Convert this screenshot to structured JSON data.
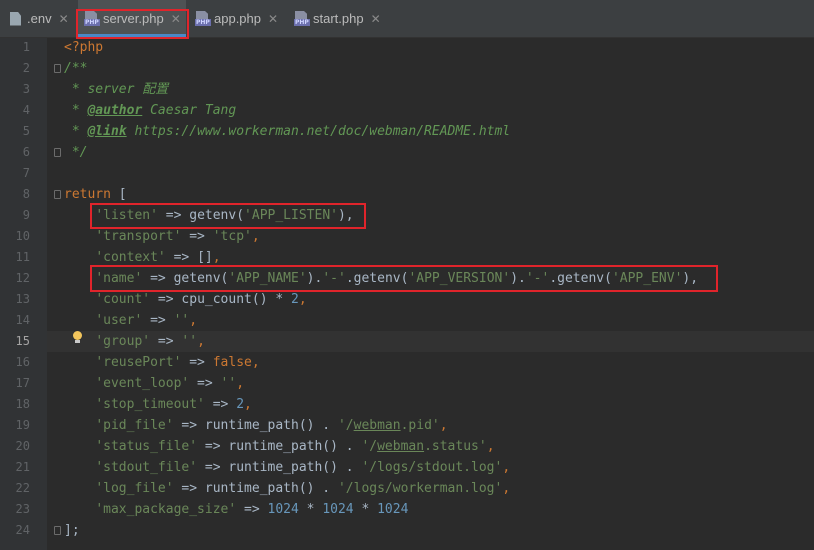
{
  "tabs": [
    {
      "label": ".env",
      "icon": "file-icon",
      "active": false
    },
    {
      "label": "server.php",
      "icon": "php-file-icon",
      "active": true
    },
    {
      "label": "app.php",
      "icon": "php-file-icon",
      "active": false
    },
    {
      "label": "start.php",
      "icon": "php-file-icon",
      "active": false
    }
  ],
  "close_glyph": "✕",
  "line_numbers": [
    "1",
    "2",
    "3",
    "4",
    "5",
    "6",
    "7",
    "8",
    "9",
    "10",
    "11",
    "12",
    "13",
    "14",
    "15",
    "16",
    "17",
    "18",
    "19",
    "20",
    "21",
    "22",
    "23",
    "24"
  ],
  "current_line": "15",
  "code": {
    "l1": {
      "open": "<?php"
    },
    "l2": {
      "text": "/**"
    },
    "l3": {
      "text": " * server 配置"
    },
    "l4": {
      "tag": "@author",
      "rest": " Caesar Tang"
    },
    "l5": {
      "tag": "@link",
      "rest": " https://www.workerman.net/doc/webman/README.html"
    },
    "l6": {
      "text": " */"
    },
    "l8": {
      "kw": "return",
      "rest": " ["
    },
    "l9": {
      "key": "'listen'",
      "arrow": " => ",
      "fn": "getenv(",
      "arg": "'APP_LISTEN'",
      "end": "),"
    },
    "l10": {
      "key": "'transport'",
      "arrow": " => ",
      "val": "'tcp'",
      "end": ","
    },
    "l11": {
      "key": "'context'",
      "arrow": " => ",
      "rest": "[]",
      "end": ","
    },
    "l12": {
      "key": "'name'",
      "arrow": " => ",
      "fn1": "getenv(",
      "a1": "'APP_NAME'",
      "c1": ").",
      "s1": "'-'",
      "c2": ".getenv(",
      "a2": "'APP_VERSION'",
      "c3": ").",
      "s2": "'-'",
      "c4": ".getenv(",
      "a3": "'APP_ENV'",
      "end": "),"
    },
    "l13": {
      "key": "'count'",
      "arrow": " => ",
      "fn": "cpu_count() * ",
      "num": "2",
      "end": ","
    },
    "l14": {
      "key": "'user'",
      "arrow": " => ",
      "val": "''",
      "end": ","
    },
    "l15": {
      "key": "'group'",
      "arrow": " => ",
      "val": "''",
      "end": ","
    },
    "l16": {
      "key": "'reusePort'",
      "arrow": " => ",
      "kwv": "false",
      "end": ","
    },
    "l17": {
      "key": "'event_loop'",
      "arrow": " => ",
      "val": "''",
      "end": ","
    },
    "l18": {
      "key": "'stop_timeout'",
      "arrow": " => ",
      "num": "2",
      "end": ","
    },
    "l19": {
      "key": "'pid_file'",
      "arrow": " => ",
      "fn": "runtime_path() . ",
      "q1": "'/",
      "u": "webman",
      "q2": ".pid'",
      "end": ","
    },
    "l20": {
      "key": "'status_file'",
      "arrow": " => ",
      "fn": "runtime_path() . ",
      "q1": "'/",
      "u": "webman",
      "q2": ".status'",
      "end": ","
    },
    "l21": {
      "key": "'stdout_file'",
      "arrow": " => ",
      "fn": "runtime_path() . ",
      "val": "'/logs/stdout.log'",
      "end": ","
    },
    "l22": {
      "key": "'log_file'",
      "arrow": " => ",
      "fn": "runtime_path() . ",
      "val": "'/logs/workerman.log'",
      "end": ","
    },
    "l23": {
      "key": "'max_package_size'",
      "arrow": " => ",
      "n1": "1024",
      "op1": " * ",
      "n2": "1024",
      "op2": " * ",
      "n3": "1024"
    },
    "l24": {
      "text": "];"
    }
  },
  "colors": {
    "highlight_box": "#e0242b",
    "keyword": "#cc7832",
    "string": "#6a8759",
    "number": "#6897bb",
    "doc_comment": "#629755"
  }
}
